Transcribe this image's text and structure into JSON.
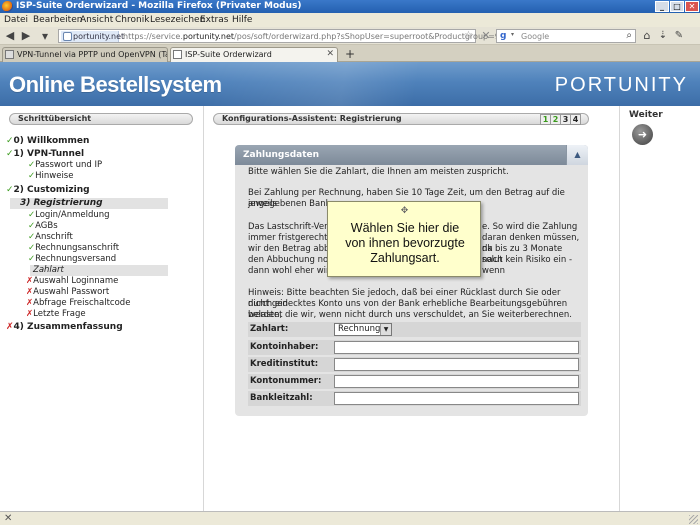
{
  "window": {
    "title": "ISP-Suite Orderwizard - Mozilla Firefox (Privater Modus)"
  },
  "menu": [
    "Datei",
    "Bearbeiten",
    "Ansicht",
    "Chronik",
    "Lesezeichen",
    "Extras",
    "Hilfe"
  ],
  "nav": {
    "site_identity": "portunity.net",
    "url_prefix": "https://service.",
    "url_domain": "portunity.net",
    "url_rest": "/pos/soft/orderwizard.php?sShopUser=superroot&Productgroup=96",
    "search_placeholder": "Google"
  },
  "tabs": [
    {
      "label": "VPN-Tunnel via PPTP und OpenVPN (Tarif...",
      "active": false
    },
    {
      "label": "ISP-Suite Orderwizard",
      "active": true
    }
  ],
  "header": {
    "brand": "Online Bestellsystem",
    "logo": "PORTUNITY"
  },
  "sidebar": {
    "title": "Schrittübersicht",
    "items": [
      {
        "label": "0) Willkommen",
        "status": "✓"
      },
      {
        "label": "1) VPN-Tunnel",
        "status": "✓"
      },
      {
        "label": "Passwort und IP",
        "status": "✓"
      },
      {
        "label": "Hinweise",
        "status": "✓"
      },
      {
        "label": "2) Customizing",
        "status": "✓"
      },
      {
        "label": "3) Registrierung",
        "status": ""
      },
      {
        "label": "Login/Anmeldung",
        "status": "✓"
      },
      {
        "label": "AGBs",
        "status": "✓"
      },
      {
        "label": "Anschrift",
        "status": "✓"
      },
      {
        "label": "Rechnungsanschrift",
        "status": "✓"
      },
      {
        "label": "Rechnungsversand",
        "status": "✓"
      },
      {
        "label": "Zahlart",
        "status": ""
      },
      {
        "label": "Auswahl Loginname",
        "status": "✗"
      },
      {
        "label": "Auswahl Passwort",
        "status": "✗"
      },
      {
        "label": "Abfrage Freischaltcode",
        "status": "✗"
      },
      {
        "label": "Letzte Frage",
        "status": "✗"
      },
      {
        "label": "4) Zusammenfassung",
        "status": "✗"
      }
    ]
  },
  "wizard": {
    "title": "Konfigurations-Assistent: Registrierung",
    "steps": [
      "1",
      "2",
      "3",
      "4"
    ],
    "steps_done": 2
  },
  "panel": {
    "title": "Zahlungsdaten",
    "intro": "Bitte wählen Sie die Zahlart, die Ihnen am meisten zuspricht.",
    "p1a": "Bei Zahlung per Rechnung, haben Sie 10 Tage Zeit, um den Betrag auf die jeweils",
    "p1b": "angegebenen Bankv",
    "p2a_left": "Das Lastschrift-Vert",
    "p2a_right": "e. So wird die Zahlung",
    "p2b_left": "immer fristgerecht v",
    "p2b_right": "daran denken müssen, da",
    "p2c_left": "wir den Betrag abbu",
    "p2c_right": "nk bis zu 3 Monate nach",
    "p2d_left": "den Abbuchung noc",
    "p2d_right": "solut kein Risiko ein - wenn",
    "p2e_left": "dann wohl eher wir :",
    "p3a": "Hinweis: Bitte beachten Sie jedoch, daß bei einer Rücklast durch Sie oder durch ein",
    "p3b": "nicht gedecktes Konto uns von der Bank erhebliche Bearbeitungsgebühren belastet",
    "p3c": "werden, die wir, wenn nicht durch uns verschuldet, an Sie weiterberechnen.",
    "fields": {
      "zahlart_label": "Zahlart:",
      "zahlart_value": "Rechnung",
      "kontoinhaber_label": "Kontoinhaber:",
      "kreditinstitut_label": "Kreditinstitut:",
      "kontonummer_label": "Kontonummer:",
      "bankleitzahl_label": "Bankleitzahl:"
    }
  },
  "tooltip": {
    "line1": "Wählen Sie hier die",
    "line2": "von ihnen bevorzugte",
    "line3": "Zahlungsart."
  },
  "right": {
    "weiter_label": "Weiter"
  },
  "colors": {
    "accent": "#4f82bb",
    "check": "#3a9a1c",
    "error": "#cc2222",
    "tooltip_bg": "#ffffcc"
  }
}
